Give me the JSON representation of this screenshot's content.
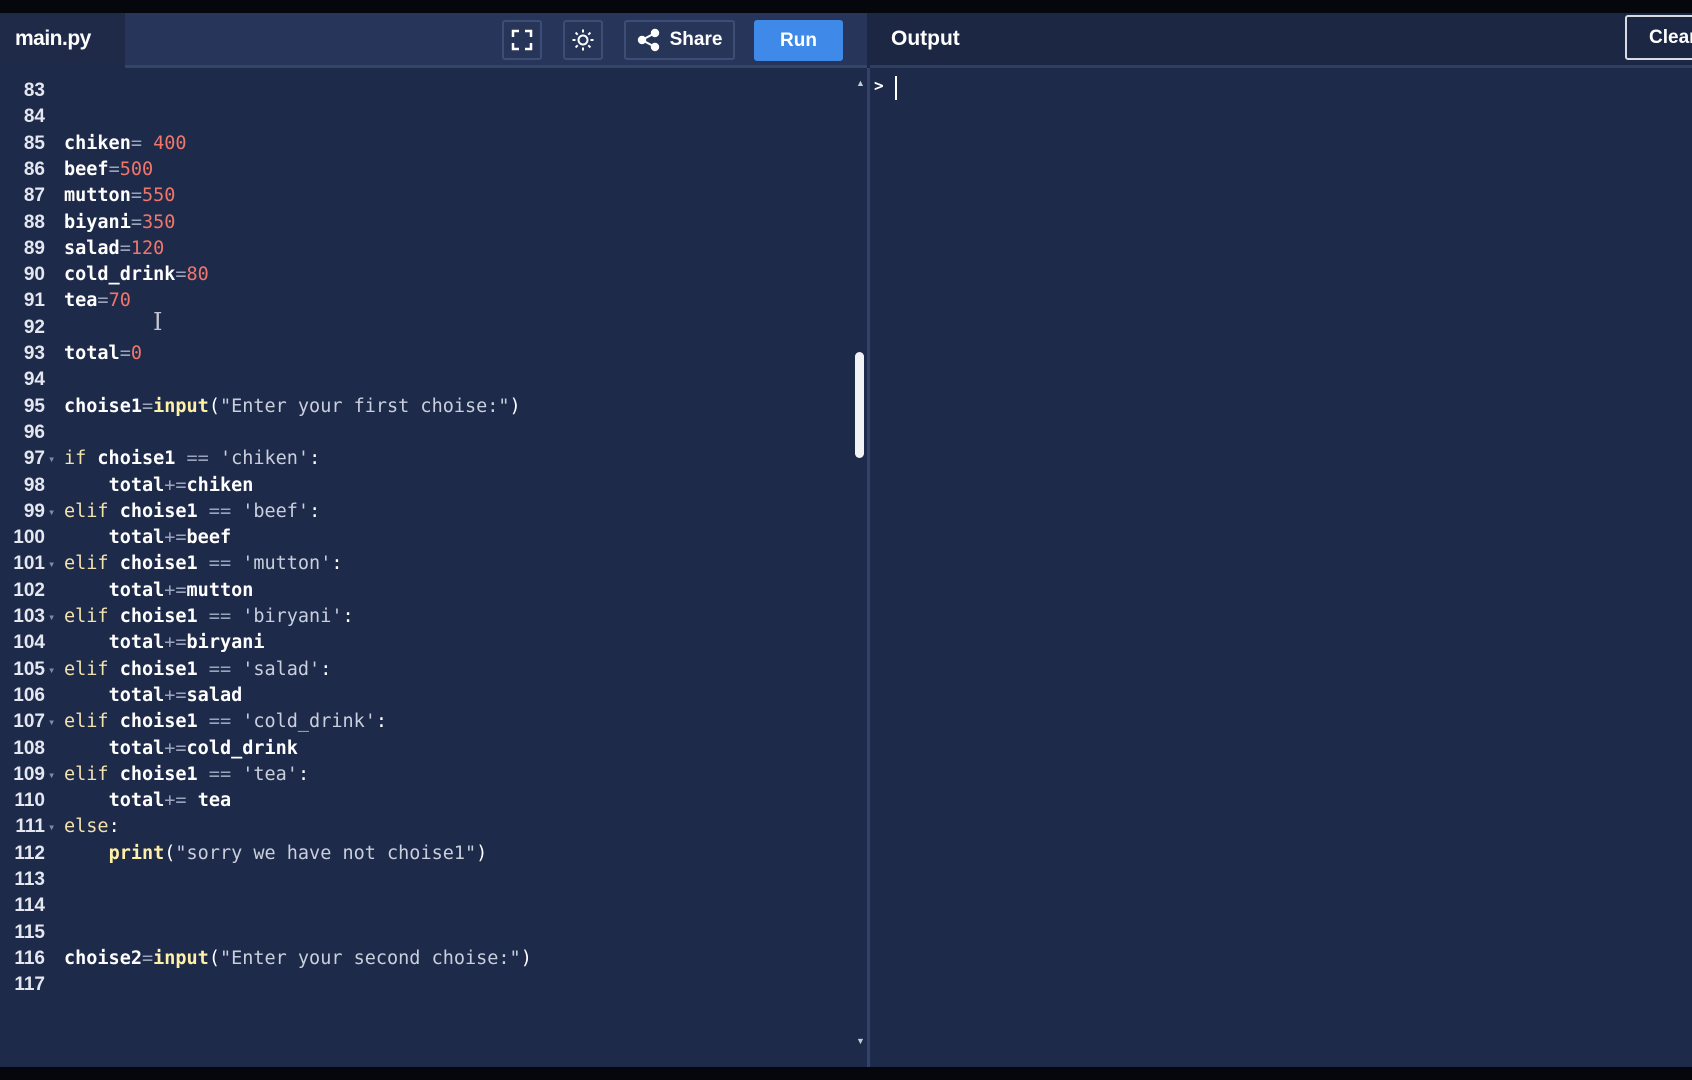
{
  "file_tab": {
    "name": "main.py"
  },
  "toolbar": {
    "fullscreen_icon": "fullscreen-icon",
    "theme_icon": "sun-icon",
    "share_label": "Share",
    "share_icon": "share-icon",
    "run_label": "Run"
  },
  "output": {
    "title": "Output",
    "clear_label": "Clear",
    "prompt": ">"
  },
  "colors": {
    "background": "#1e2a4a",
    "run_button": "#3f8ae8",
    "number": "#f0766a",
    "keyword": "#f2e2ad"
  },
  "code": {
    "lines": [
      {
        "n": "83",
        "fold": false,
        "tokens": []
      },
      {
        "n": "84",
        "fold": false,
        "tokens": []
      },
      {
        "n": "85",
        "fold": false,
        "tokens": [
          {
            "t": "id",
            "v": "chiken"
          },
          {
            "t": "op",
            "v": "= "
          },
          {
            "t": "num",
            "v": "400"
          }
        ]
      },
      {
        "n": "86",
        "fold": false,
        "tokens": [
          {
            "t": "id",
            "v": "beef"
          },
          {
            "t": "op",
            "v": "="
          },
          {
            "t": "num",
            "v": "500"
          }
        ]
      },
      {
        "n": "87",
        "fold": false,
        "tokens": [
          {
            "t": "id",
            "v": "mutton"
          },
          {
            "t": "op",
            "v": "="
          },
          {
            "t": "num",
            "v": "550"
          }
        ]
      },
      {
        "n": "88",
        "fold": false,
        "tokens": [
          {
            "t": "id",
            "v": "biyani"
          },
          {
            "t": "op",
            "v": "="
          },
          {
            "t": "num",
            "v": "350"
          }
        ]
      },
      {
        "n": "89",
        "fold": false,
        "tokens": [
          {
            "t": "id",
            "v": "salad"
          },
          {
            "t": "op",
            "v": "="
          },
          {
            "t": "num",
            "v": "120"
          }
        ]
      },
      {
        "n": "90",
        "fold": false,
        "tokens": [
          {
            "t": "id",
            "v": "cold_drink"
          },
          {
            "t": "op",
            "v": "="
          },
          {
            "t": "num",
            "v": "80"
          }
        ]
      },
      {
        "n": "91",
        "fold": false,
        "tokens": [
          {
            "t": "id",
            "v": "tea"
          },
          {
            "t": "op",
            "v": "="
          },
          {
            "t": "num",
            "v": "70"
          }
        ]
      },
      {
        "n": "92",
        "fold": false,
        "tokens": []
      },
      {
        "n": "93",
        "fold": false,
        "tokens": [
          {
            "t": "id",
            "v": "total"
          },
          {
            "t": "op",
            "v": "="
          },
          {
            "t": "num",
            "v": "0"
          }
        ]
      },
      {
        "n": "94",
        "fold": false,
        "tokens": []
      },
      {
        "n": "95",
        "fold": false,
        "tokens": [
          {
            "t": "id",
            "v": "choise1"
          },
          {
            "t": "op",
            "v": "="
          },
          {
            "t": "fn",
            "v": "input"
          },
          {
            "t": "punc",
            "v": "("
          },
          {
            "t": "str",
            "v": "\"Enter your first choise:\""
          },
          {
            "t": "punc",
            "v": ")"
          }
        ]
      },
      {
        "n": "96",
        "fold": false,
        "tokens": []
      },
      {
        "n": "97",
        "fold": true,
        "tokens": [
          {
            "t": "kw",
            "v": "if "
          },
          {
            "t": "id",
            "v": "choise1"
          },
          {
            "t": "op",
            "v": " == "
          },
          {
            "t": "str",
            "v": "'chiken'"
          },
          {
            "t": "punc",
            "v": ":"
          }
        ]
      },
      {
        "n": "98",
        "fold": false,
        "tokens": [
          {
            "t": "op",
            "v": "    "
          },
          {
            "t": "id",
            "v": "total"
          },
          {
            "t": "op",
            "v": "+="
          },
          {
            "t": "id",
            "v": "chiken"
          }
        ]
      },
      {
        "n": "99",
        "fold": true,
        "tokens": [
          {
            "t": "kw",
            "v": "elif "
          },
          {
            "t": "id",
            "v": "choise1"
          },
          {
            "t": "op",
            "v": " == "
          },
          {
            "t": "str",
            "v": "'beef'"
          },
          {
            "t": "punc",
            "v": ":"
          }
        ]
      },
      {
        "n": "100",
        "fold": false,
        "tokens": [
          {
            "t": "op",
            "v": "    "
          },
          {
            "t": "id",
            "v": "total"
          },
          {
            "t": "op",
            "v": "+="
          },
          {
            "t": "id",
            "v": "beef"
          }
        ]
      },
      {
        "n": "101",
        "fold": true,
        "tokens": [
          {
            "t": "kw",
            "v": "elif "
          },
          {
            "t": "id",
            "v": "choise1"
          },
          {
            "t": "op",
            "v": " == "
          },
          {
            "t": "str",
            "v": "'mutton'"
          },
          {
            "t": "punc",
            "v": ":"
          }
        ]
      },
      {
        "n": "102",
        "fold": false,
        "tokens": [
          {
            "t": "op",
            "v": "    "
          },
          {
            "t": "id",
            "v": "total"
          },
          {
            "t": "op",
            "v": "+="
          },
          {
            "t": "id",
            "v": "mutton"
          }
        ]
      },
      {
        "n": "103",
        "fold": true,
        "tokens": [
          {
            "t": "kw",
            "v": "elif "
          },
          {
            "t": "id",
            "v": "choise1"
          },
          {
            "t": "op",
            "v": " == "
          },
          {
            "t": "str",
            "v": "'biryani'"
          },
          {
            "t": "punc",
            "v": ":"
          }
        ]
      },
      {
        "n": "104",
        "fold": false,
        "tokens": [
          {
            "t": "op",
            "v": "    "
          },
          {
            "t": "id",
            "v": "total"
          },
          {
            "t": "op",
            "v": "+="
          },
          {
            "t": "id",
            "v": "biryani"
          }
        ]
      },
      {
        "n": "105",
        "fold": true,
        "tokens": [
          {
            "t": "kw",
            "v": "elif "
          },
          {
            "t": "id",
            "v": "choise1"
          },
          {
            "t": "op",
            "v": " == "
          },
          {
            "t": "str",
            "v": "'salad'"
          },
          {
            "t": "punc",
            "v": ":"
          }
        ]
      },
      {
        "n": "106",
        "fold": false,
        "tokens": [
          {
            "t": "op",
            "v": "    "
          },
          {
            "t": "id",
            "v": "total"
          },
          {
            "t": "op",
            "v": "+="
          },
          {
            "t": "id",
            "v": "salad"
          }
        ]
      },
      {
        "n": "107",
        "fold": true,
        "tokens": [
          {
            "t": "kw",
            "v": "elif "
          },
          {
            "t": "id",
            "v": "choise1"
          },
          {
            "t": "op",
            "v": " == "
          },
          {
            "t": "str",
            "v": "'cold_drink'"
          },
          {
            "t": "punc",
            "v": ":"
          }
        ]
      },
      {
        "n": "108",
        "fold": false,
        "tokens": [
          {
            "t": "op",
            "v": "    "
          },
          {
            "t": "id",
            "v": "total"
          },
          {
            "t": "op",
            "v": "+="
          },
          {
            "t": "id",
            "v": "cold_drink"
          }
        ]
      },
      {
        "n": "109",
        "fold": true,
        "tokens": [
          {
            "t": "kw",
            "v": "elif "
          },
          {
            "t": "id",
            "v": "choise1"
          },
          {
            "t": "op",
            "v": " == "
          },
          {
            "t": "str",
            "v": "'tea'"
          },
          {
            "t": "punc",
            "v": ":"
          }
        ]
      },
      {
        "n": "110",
        "fold": false,
        "tokens": [
          {
            "t": "op",
            "v": "    "
          },
          {
            "t": "id",
            "v": "total"
          },
          {
            "t": "op",
            "v": "+= "
          },
          {
            "t": "id",
            "v": "tea"
          }
        ]
      },
      {
        "n": "111",
        "fold": true,
        "tokens": [
          {
            "t": "kw",
            "v": "else"
          },
          {
            "t": "punc",
            "v": ":"
          }
        ]
      },
      {
        "n": "112",
        "fold": false,
        "tokens": [
          {
            "t": "op",
            "v": "    "
          },
          {
            "t": "fn",
            "v": "print"
          },
          {
            "t": "punc",
            "v": "("
          },
          {
            "t": "str",
            "v": "\"sorry we have not choise1\""
          },
          {
            "t": "punc",
            "v": ")"
          }
        ]
      },
      {
        "n": "113",
        "fold": false,
        "tokens": []
      },
      {
        "n": "114",
        "fold": false,
        "tokens": []
      },
      {
        "n": "115",
        "fold": false,
        "tokens": []
      },
      {
        "n": "116",
        "fold": false,
        "tokens": [
          {
            "t": "id",
            "v": "choise2"
          },
          {
            "t": "op",
            "v": "="
          },
          {
            "t": "fn",
            "v": "input"
          },
          {
            "t": "punc",
            "v": "("
          },
          {
            "t": "str",
            "v": "\"Enter your second choise:\""
          },
          {
            "t": "punc",
            "v": ")"
          }
        ]
      },
      {
        "n": "117",
        "fold": false,
        "tokens": []
      }
    ]
  }
}
